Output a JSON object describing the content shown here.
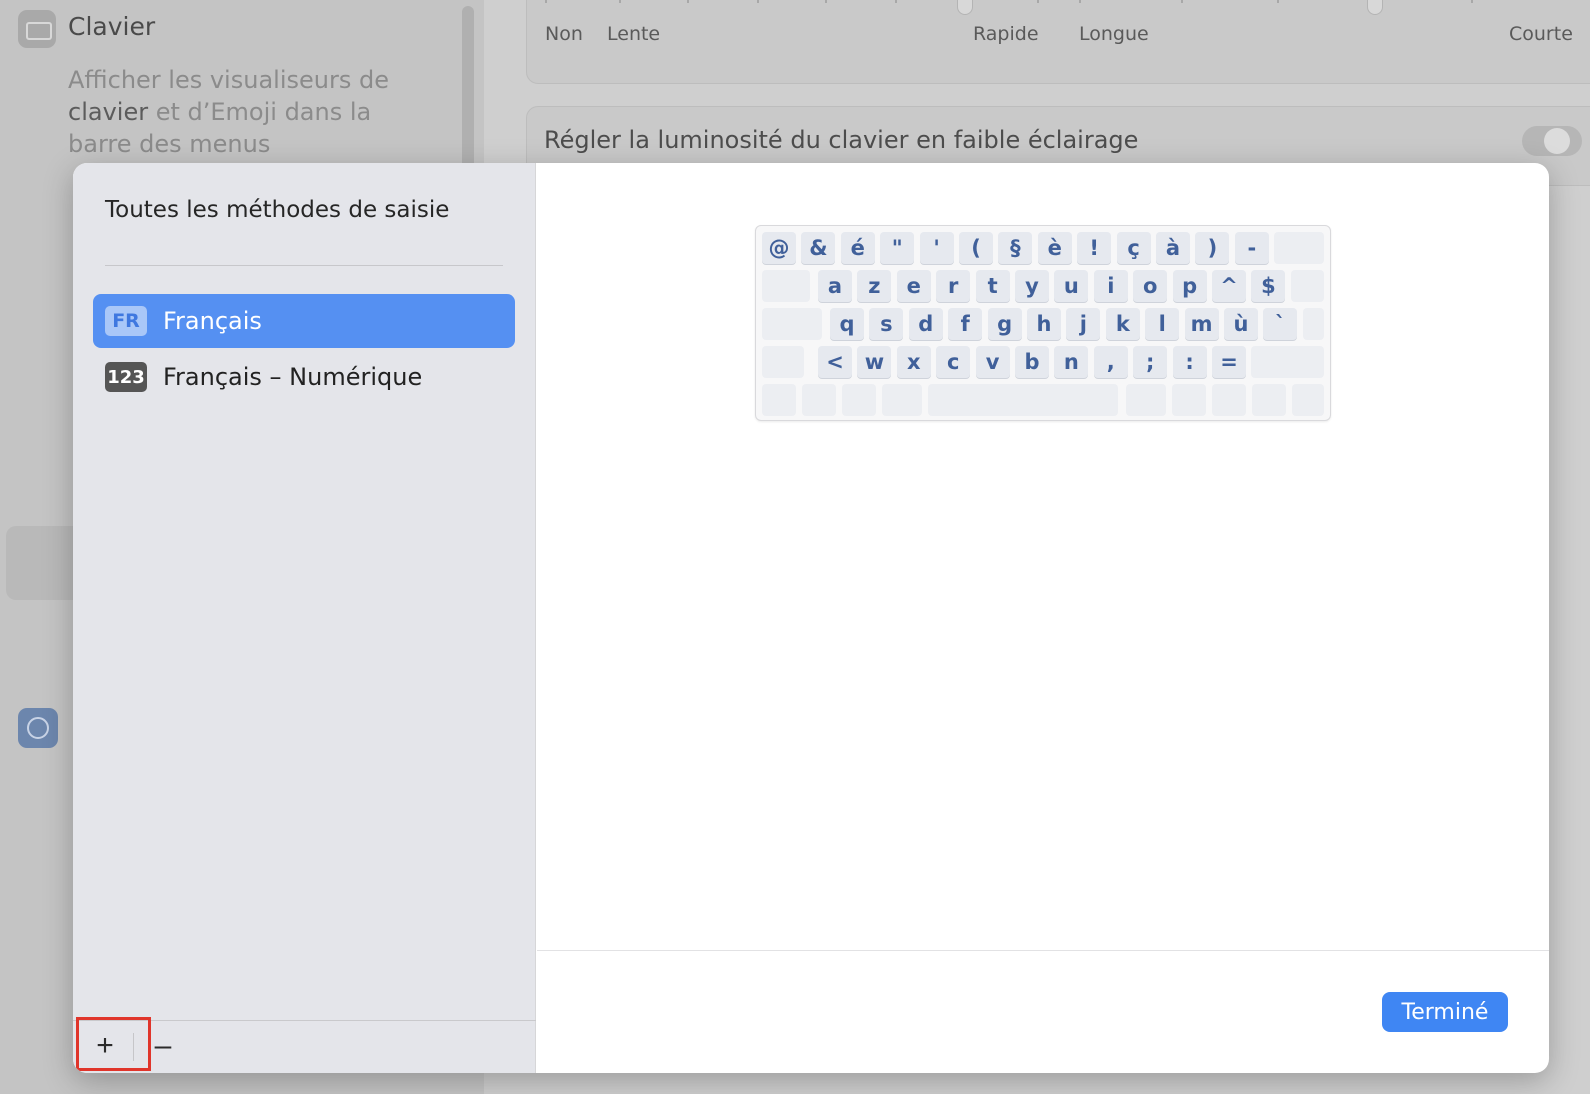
{
  "background": {
    "sidebar": {
      "keyboard_title": "Clavier",
      "keyboard_desc_1": "Afficher les visualiseurs de",
      "keyboard_desc_2": "clavier",
      "keyboard_desc_3": " et d’Emoji dans la",
      "keyboard_desc_4": "barre des menus",
      "keyboard_icon": "keyboard-icon",
      "accessibility_icon": "accessibility-icon"
    },
    "sliders": {
      "repeat_labels": [
        "Non",
        "Lente",
        "Rapide"
      ],
      "delay_labels": [
        "Longue",
        "Courte"
      ]
    },
    "brightness_label": "Régler la luminosité du clavier en faible éclairage"
  },
  "sheet": {
    "title": "Toutes les méthodes de saisie",
    "items": [
      {
        "badge": "FR",
        "label": "Français",
        "selected": true
      },
      {
        "badge": "123",
        "label": "Français – Numérique",
        "selected": false
      }
    ],
    "add_label": "+",
    "remove_label": "–",
    "done_label": "Terminé",
    "accent_color": "#5590f2",
    "highlight_color": "#e0352b"
  },
  "keyboard": {
    "row1": [
      "@",
      "&",
      "é",
      "\"",
      "'",
      "(",
      "§",
      "è",
      "!",
      "ç",
      "à",
      ")",
      "-"
    ],
    "row2": [
      "a",
      "z",
      "e",
      "r",
      "t",
      "y",
      "u",
      "i",
      "o",
      "p",
      "^",
      "$"
    ],
    "row3": [
      "q",
      "s",
      "d",
      "f",
      "g",
      "h",
      "j",
      "k",
      "l",
      "m",
      "ù",
      "`"
    ],
    "row4": [
      "<",
      "w",
      "x",
      "c",
      "v",
      "b",
      "n",
      ",",
      ";",
      ":",
      "="
    ]
  }
}
